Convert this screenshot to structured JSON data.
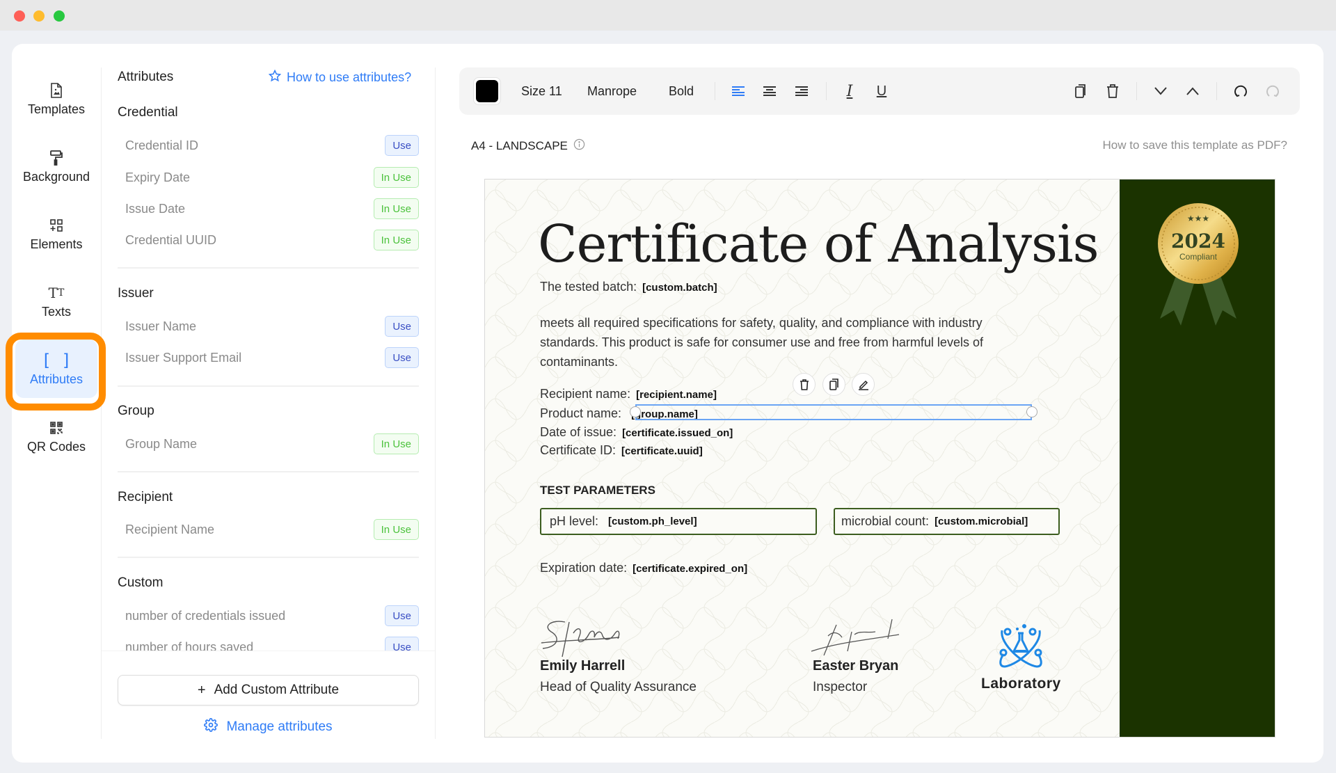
{
  "window": {
    "controls": [
      "close",
      "minimize",
      "maximize"
    ]
  },
  "nav": {
    "items": [
      {
        "id": "templates",
        "label": "Templates",
        "icon": "file-image-icon",
        "active": false
      },
      {
        "id": "background",
        "label": "Background",
        "icon": "paint-roller-icon",
        "active": false
      },
      {
        "id": "elements",
        "label": "Elements",
        "icon": "elements-grid-icon",
        "active": false
      },
      {
        "id": "texts",
        "label": "Texts",
        "icon": "text-size-icon",
        "active": false
      },
      {
        "id": "attributes",
        "label": "Attributes",
        "icon": "brackets-icon",
        "active": true
      },
      {
        "id": "qr-codes",
        "label": "QR Codes",
        "icon": "qr-code-icon",
        "active": false
      }
    ]
  },
  "panel": {
    "title": "Attributes",
    "help_link": "How to use attributes?",
    "sections": [
      {
        "title": "Credential",
        "items": [
          {
            "name": "Credential ID",
            "status": "Use"
          },
          {
            "name": "Expiry Date",
            "status": "In Use"
          },
          {
            "name": "Issue Date",
            "status": "In Use"
          },
          {
            "name": "Credential UUID",
            "status": "In Use"
          }
        ]
      },
      {
        "title": "Issuer",
        "items": [
          {
            "name": "Issuer Name",
            "status": "Use"
          },
          {
            "name": "Issuer Support Email",
            "status": "Use"
          }
        ]
      },
      {
        "title": "Group",
        "items": [
          {
            "name": "Group Name",
            "status": "In Use"
          }
        ]
      },
      {
        "title": "Recipient",
        "items": [
          {
            "name": "Recipient Name",
            "status": "In Use"
          }
        ]
      },
      {
        "title": "Custom",
        "items": [
          {
            "name": "number of credentials issued",
            "status": "Use"
          },
          {
            "name": "number of hours saved",
            "status": "Use"
          }
        ]
      }
    ],
    "add_button": "Add Custom Attribute",
    "manage_link": "Manage attributes"
  },
  "toolbar": {
    "color": "#000000",
    "size": "Size 11",
    "font": "Manrope",
    "weight": "Bold",
    "align_active": "left"
  },
  "canvas": {
    "page_size": "A4 - LANDSCAPE",
    "pdf_help": "How to save this template as PDF?"
  },
  "certificate": {
    "title": "Certificate of Analysis",
    "batch_label": "The tested batch:",
    "batch_var": "[custom.batch]",
    "paragraph": "meets all required specifications for safety, quality, and compliance with industry standards. This product is safe for consumer use and free from harmful levels of contaminants.",
    "fields": [
      {
        "label": "Recipient name:",
        "value": "[recipient.name]"
      },
      {
        "label": "Product name:",
        "value": "[group.name]"
      },
      {
        "label": "Date of issue:",
        "value": "[certificate.issued_on]"
      },
      {
        "label": "Certificate ID:",
        "value": "[certificate.uuid]"
      }
    ],
    "params_title": "TEST PARAMETERS",
    "params": [
      {
        "label": "pH level:",
        "value": "[custom.ph_level]"
      },
      {
        "label": "microbial count:",
        "value": "[custom.microbial]"
      }
    ],
    "expiration_label": "Expiration date:",
    "expiration_value": "[certificate.expired_on]",
    "signatures": [
      {
        "name": "Emily Harrell",
        "role": "Head of Quality Assurance"
      },
      {
        "name": "Easter Bryan",
        "role": "Inspector"
      }
    ],
    "logo_text": "Laboratory",
    "medal": {
      "year": "2024",
      "text": "Compliant"
    },
    "colors": {
      "side_panel": "#1b3300",
      "accent_blue": "#2f7cf6",
      "logo_blue": "#1e88e5",
      "highlight": "#ff8c00"
    }
  }
}
